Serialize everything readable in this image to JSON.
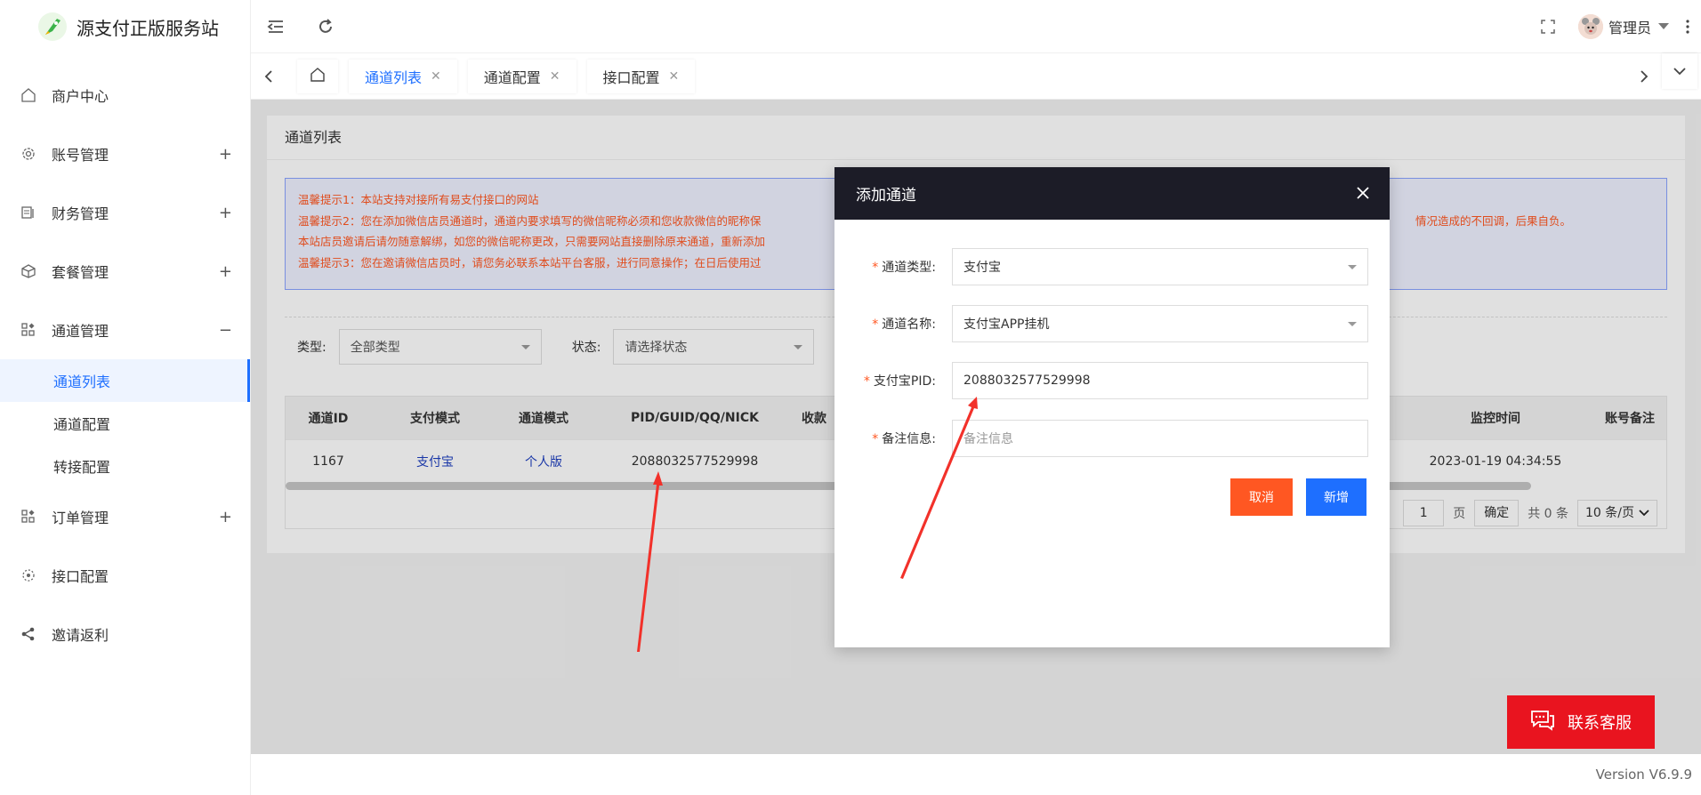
{
  "app": {
    "title": "源支付正版服务站",
    "version": "Version V6.9.9"
  },
  "sidebar": {
    "items": [
      {
        "label": "商户中心",
        "icon": "home-icon",
        "toggle": ""
      },
      {
        "label": "账号管理",
        "icon": "gear-icon",
        "toggle": "+"
      },
      {
        "label": "财务管理",
        "icon": "finance-icon",
        "toggle": "+"
      },
      {
        "label": "套餐管理",
        "icon": "package-icon",
        "toggle": "+"
      },
      {
        "label": "通道管理",
        "icon": "grid-icon",
        "toggle": "−"
      }
    ],
    "subitems": [
      {
        "label": "通道列表"
      },
      {
        "label": "通道配置"
      },
      {
        "label": "转接配置"
      }
    ],
    "items2": [
      {
        "label": "订单管理",
        "icon": "grid-icon",
        "toggle": "+"
      },
      {
        "label": "接口配置",
        "icon": "settings-icon",
        "toggle": ""
      },
      {
        "label": "邀请返利",
        "icon": "share-icon",
        "toggle": ""
      }
    ]
  },
  "header": {
    "user": "管理员"
  },
  "tabs": [
    {
      "label": "通道列表"
    },
    {
      "label": "通道配置"
    },
    {
      "label": "接口配置"
    }
  ],
  "page": {
    "title": "通道列表",
    "notices": [
      "温馨提示1：本站支持对接所有易支付接口的网站",
      "温馨提示2：您在添加微信店员通道时，通道内要求填写的微信昵称必须和您收款微信的昵称保",
      "本站店员邀请后请勿随意解绑，如您的微信昵称更改，只需要网站直接删除原来通道，重新添加",
      "温馨提示3：您在邀请微信店员时，请您务必联系本站平台客服，进行同意操作；在日后使用过"
    ],
    "notice_tail": "情况造成的不回调，后果自负。",
    "filters": {
      "type_label": "类型:",
      "type_value": "全部类型",
      "status_label": "状态:",
      "status_value": "请选择状态"
    },
    "table": {
      "headers": [
        "通道ID",
        "支付模式",
        "通道模式",
        "PID/GUID/QQ/NICK",
        "收款",
        "监控时间",
        "账号备注"
      ],
      "row": {
        "id": "1167",
        "pay_mode": "支付宝",
        "channel_mode": "个人版",
        "pid": "2088032577529998",
        "monitor_time": "2023-01-19 04:34:55"
      }
    },
    "pager": {
      "page": "1",
      "page_unit": "页",
      "confirm": "确定",
      "total": "共 0 条",
      "size": "10 条/页"
    }
  },
  "modal": {
    "title": "添加通道",
    "fields": [
      {
        "label": "通道类型:",
        "value": "支付宝"
      },
      {
        "label": "通道名称:",
        "value": "支付宝APP挂机"
      },
      {
        "label": "支付宝PID:",
        "value": "2088032577529998"
      },
      {
        "label": "备注信息:",
        "placeholder": "备注信息"
      }
    ],
    "cancel": "取消",
    "submit": "新增"
  },
  "contact": {
    "label": "联系客服"
  },
  "colors": {
    "accent": "#1e6fff",
    "danger": "#ff5722",
    "contact": "#e9141f",
    "modal_head": "#1c1c27"
  }
}
